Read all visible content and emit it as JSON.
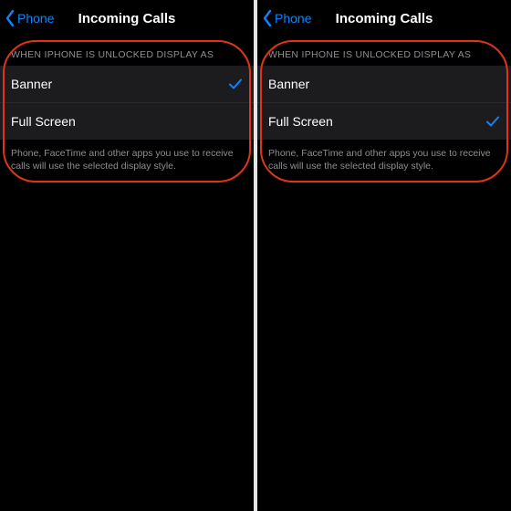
{
  "left": {
    "backLabel": "Phone",
    "title": "Incoming Calls",
    "sectionHeader": "WHEN IPHONE IS UNLOCKED DISPLAY AS",
    "options": {
      "banner": "Banner",
      "fullscreen": "Full Screen"
    },
    "selected": "banner",
    "footer": "Phone, FaceTime and other apps you use to receive calls will use the selected display style."
  },
  "right": {
    "backLabel": "Phone",
    "title": "Incoming Calls",
    "sectionHeader": "WHEN IPHONE IS UNLOCKED DISPLAY AS",
    "options": {
      "banner": "Banner",
      "fullscreen": "Full Screen"
    },
    "selected": "fullscreen",
    "footer": "Phone, FaceTime and other apps you use to receive calls will use the selected display style."
  }
}
